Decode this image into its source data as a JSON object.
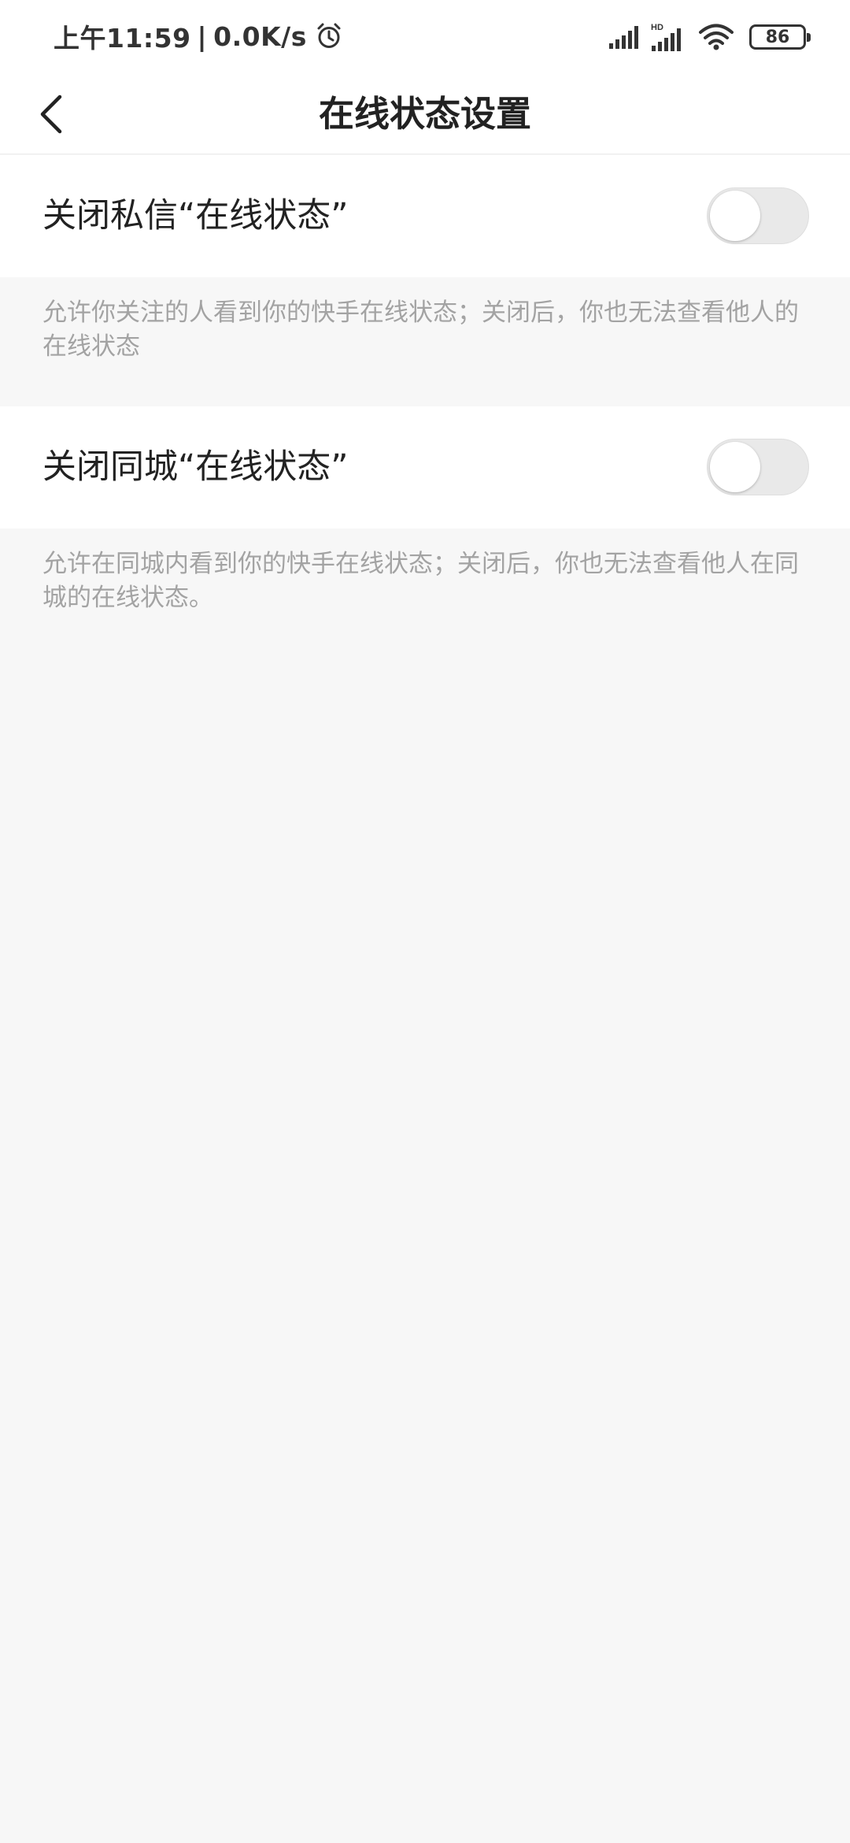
{
  "status_bar": {
    "time": "上午11:59",
    "separator": "|",
    "net_speed": "0.0K/s",
    "hd_label": "HD",
    "battery_level": "86",
    "icons": [
      "alarm-icon",
      "signal-icon",
      "hd-signal-icon",
      "wifi-icon",
      "battery-icon"
    ]
  },
  "nav": {
    "title": "在线状态设置",
    "back_icon": "chevron-left-icon"
  },
  "settings": [
    {
      "label": "关闭私信“在线状态”",
      "enabled": false,
      "description": "允许你关注的人看到你的快手在线状态；关闭后，你也无法查看他人的在线状态"
    },
    {
      "label": "关闭同城“在线状态”",
      "enabled": false,
      "description": "允许在同城内看到你的快手在线状态；关闭后，你也无法查看他人在同城的在线状态。"
    }
  ],
  "colors": {
    "background": "#f7f7f7",
    "card": "#ffffff",
    "text_primary": "#222222",
    "text_secondary": "#a3a3a3",
    "toggle_off_track": "#e9e9e9"
  }
}
